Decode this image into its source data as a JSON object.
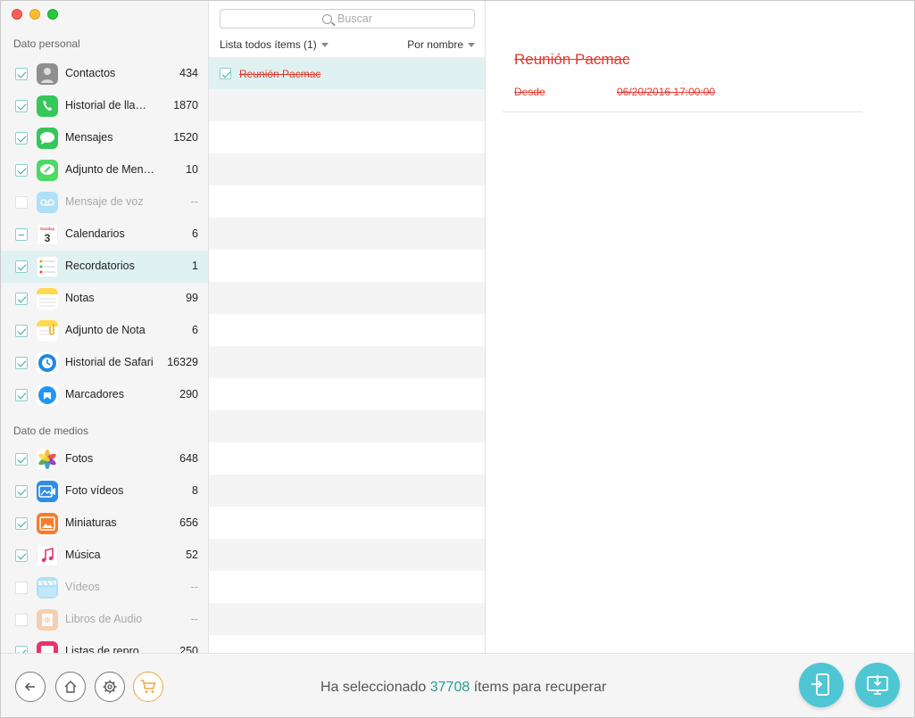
{
  "sidebar": {
    "personal_title": "Dato personal",
    "media_title": "Dato de medios",
    "personal_items": [
      {
        "label": "Contactos",
        "count": "434",
        "state": "checked",
        "icon": "contacts-icon",
        "color": "#9b9b9b"
      },
      {
        "label": "Historial de lla…",
        "count": "1870",
        "state": "checked",
        "icon": "phone-icon",
        "color": "#34c759"
      },
      {
        "label": "Mensajes",
        "count": "1520",
        "state": "checked",
        "icon": "messages-icon",
        "color": "#34c759"
      },
      {
        "label": "Adjunto de Men…",
        "count": "10",
        "state": "checked",
        "icon": "message-attachment-icon",
        "color": "#4cd964"
      },
      {
        "label": "Mensaje de voz",
        "count": "--",
        "state": "disabled",
        "icon": "voicemail-icon",
        "color": "#5ac8fa"
      },
      {
        "label": "Calendarios",
        "count": "6",
        "state": "partial",
        "icon": "calendar-icon",
        "color": "#ffffff"
      },
      {
        "label": "Recordatorios",
        "count": "1",
        "state": "checked",
        "icon": "reminders-icon",
        "color": "#ffffff",
        "selected": true
      },
      {
        "label": "Notas",
        "count": "99",
        "state": "checked",
        "icon": "notes-icon",
        "color": "#ffd84d"
      },
      {
        "label": "Adjunto de Nota",
        "count": "6",
        "state": "checked",
        "icon": "note-attachment-icon",
        "color": "#ffd84d"
      },
      {
        "label": "Historial de Safari",
        "count": "16329",
        "state": "checked",
        "icon": "safari-history-icon",
        "color": "#1e88e5"
      },
      {
        "label": "Marcadores",
        "count": "290",
        "state": "checked",
        "icon": "bookmarks-icon",
        "color": "#2196f3"
      }
    ],
    "media_items": [
      {
        "label": "Fotos",
        "count": "648",
        "state": "checked",
        "icon": "photos-icon",
        "color": "#ffffff"
      },
      {
        "label": "Foto vídeos",
        "count": "8",
        "state": "checked",
        "icon": "photo-videos-icon",
        "color": "#2e8de6"
      },
      {
        "label": "Miniaturas",
        "count": "656",
        "state": "checked",
        "icon": "thumbnails-icon",
        "color": "#f57c2c"
      },
      {
        "label": "Música",
        "count": "52",
        "state": "checked",
        "icon": "music-icon",
        "color": "#ffffff"
      },
      {
        "label": "Vídeos",
        "count": "--",
        "state": "disabled",
        "icon": "videos-icon",
        "color": "#5ac8fa"
      },
      {
        "label": "Libros de Audio",
        "count": "--",
        "state": "disabled",
        "icon": "audiobooks-icon",
        "color": "#f5a35c"
      },
      {
        "label": "Listas de repro…",
        "count": "250",
        "state": "checked",
        "icon": "playlists-icon",
        "color": "#e8336c"
      }
    ]
  },
  "list": {
    "search_placeholder": "Buscar",
    "filter_label": "Lista todos ítems (1)",
    "sort_label": "Por nombre",
    "items": [
      {
        "title": "Reunión Pacmac",
        "checked": true,
        "selected": true
      }
    ],
    "row_count": 19
  },
  "detail": {
    "title": "Reunión Pacmac",
    "from_label": "Desde",
    "from_value": "06/20/2016 17:00:00"
  },
  "footer": {
    "status_prefix": "Ha seleccionado",
    "status_count": "37708",
    "status_suffix": "ítems para recuperar"
  },
  "colors": {
    "accent": "#2a9e95",
    "deleted": "#e0392f",
    "action": "#4ec6d3",
    "cart": "#f0a640"
  }
}
